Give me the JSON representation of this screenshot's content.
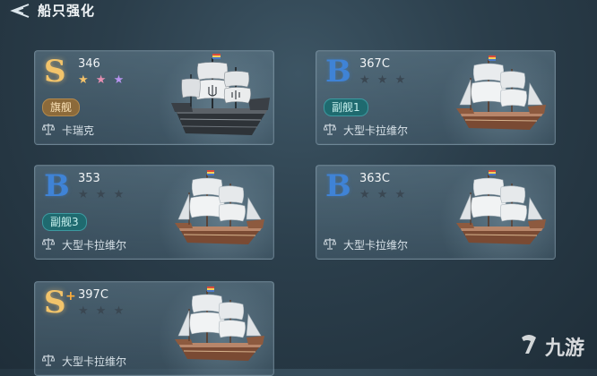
{
  "header": {
    "title": "船只强化"
  },
  "colors": {
    "grade_s": "#f2c46b",
    "grade_b": "#3f83d6",
    "badge_flagship": "#8c6a3a",
    "badge_vice": "#1f6a6f"
  },
  "icons": {
    "back": "back-arrow-icon",
    "ship_type": "scale-icon",
    "watermark": "nine-games-logo-icon"
  },
  "cards": [
    {
      "grade": "S",
      "grade_plus": "",
      "id": "346",
      "stars": [
        "★",
        "★",
        "★"
      ],
      "stars_lit": 3,
      "role": "旗舰",
      "type": "卡瑞克",
      "ship": "dark-carrack"
    },
    {
      "grade": "B",
      "grade_plus": "",
      "id": "367C",
      "stars": [
        "★",
        "★",
        "★"
      ],
      "stars_lit": 0,
      "role": "副舰1",
      "type": "大型卡拉维尔",
      "ship": "large-caravel"
    },
    {
      "grade": "B",
      "grade_plus": "",
      "id": "353",
      "stars": [
        "★",
        "★",
        "★"
      ],
      "stars_lit": 0,
      "role": "副舰3",
      "type": "大型卡拉维尔",
      "ship": "large-caravel"
    },
    {
      "grade": "B",
      "grade_plus": "",
      "id": "363C",
      "stars": [
        "★",
        "★",
        "★"
      ],
      "stars_lit": 0,
      "role": "",
      "type": "大型卡拉维尔",
      "ship": "large-caravel"
    },
    {
      "grade": "S",
      "grade_plus": "+",
      "id": "397C",
      "stars": [
        "★",
        "★",
        "★"
      ],
      "stars_lit": 0,
      "role": "",
      "type": "大型卡拉维尔",
      "ship": "large-caravel"
    }
  ],
  "watermark": {
    "text": "九游"
  }
}
